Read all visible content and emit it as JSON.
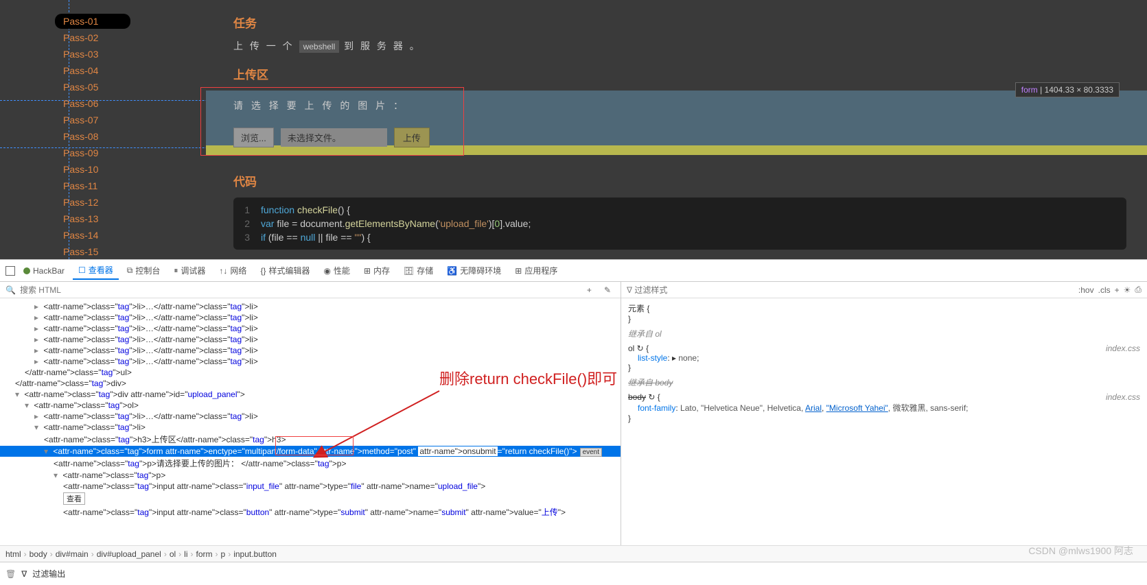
{
  "sidebar": {
    "items": [
      {
        "label": "Pass-01",
        "active": true
      },
      {
        "label": "Pass-02",
        "active": false
      },
      {
        "label": "Pass-03",
        "active": false
      },
      {
        "label": "Pass-04",
        "active": false
      },
      {
        "label": "Pass-05",
        "active": false
      },
      {
        "label": "Pass-06",
        "active": false
      },
      {
        "label": "Pass-07",
        "active": false
      },
      {
        "label": "Pass-08",
        "active": false
      },
      {
        "label": "Pass-09",
        "active": false
      },
      {
        "label": "Pass-10",
        "active": false
      },
      {
        "label": "Pass-11",
        "active": false
      },
      {
        "label": "Pass-12",
        "active": false
      },
      {
        "label": "Pass-13",
        "active": false
      },
      {
        "label": "Pass-14",
        "active": false
      },
      {
        "label": "Pass-15",
        "active": false
      }
    ]
  },
  "main": {
    "task_title": "任务",
    "task_prefix": "上 传 一 个 ",
    "task_code": "webshell",
    "task_suffix": " 到 服 务 器 。",
    "upload_title": "上传区",
    "upload_label": "请 选 择 要 上 传 的 图 片 ：",
    "browse_label": "浏览...",
    "file_status": "未选择文件。",
    "upload_button": "上传",
    "code_title": "代码",
    "dimensions_tooltip_tag": "form",
    "dimensions_tooltip_size": "1404.33 × 80.3333"
  },
  "code": {
    "lines": [
      {
        "n": "1",
        "html": "<span class='kw'>function</span> <span class='fn'>checkFile</span>() {"
      },
      {
        "n": "2",
        "html": "    <span class='kw'>var</span> file = document.<span class='fn'>getElementsByName</span>(<span class='str'>'upload_file'</span>)[<span class='num'>0</span>].value;"
      },
      {
        "n": "3",
        "html": "    <span class='kw'>if</span> (file == <span class='kw'>null</span> || file == <span class='str'>\"\"</span>) {"
      }
    ]
  },
  "devtools": {
    "tabs": {
      "hackbar": "HackBar",
      "inspector": "查看器",
      "console": "控制台",
      "debugger": "调试器",
      "network": "网络",
      "style_editor": "样式编辑器",
      "performance": "性能",
      "memory": "内存",
      "storage": "存储",
      "accessibility": "无障碍环境",
      "application": "应用程序"
    },
    "search_placeholder": "搜索 HTML",
    "add_button": "+",
    "styles_filter_placeholder": "过滤样式",
    "styles_toolbar": {
      "hov": ":hov",
      "cls": ".cls"
    },
    "styles": {
      "element_label": "元素",
      "inherit_ol": "继承自 ol",
      "ol_selector": "ol",
      "ol_src": "index.css",
      "list_style_prop": "list-style",
      "list_style_val": "none",
      "inherit_body_strike": "继承自 body",
      "body_selector": "body",
      "body_src": "index.css",
      "font_family_prop": "font-family",
      "font_family_val_plain": "Lato, \"Helvetica Neue\", Helvetica, ",
      "font_family_arial": "Arial",
      "font_family_ms": "\"Microsoft Yahei\"",
      "font_family_tail": ", 微软雅黑, sans-serif;"
    },
    "dom": {
      "li_generic": "<li>…</li>",
      "ul_close": "</ul>",
      "div_close": "</div>",
      "div_upload": "<div id=\"upload_panel\">",
      "ol_open": "<ol>",
      "li_open": "<li>",
      "h3_text": "上传区",
      "form_line_pre": "<form enctype=\"multipart/form-data\" method=\"post\" ",
      "form_attr": "onsubmit=\"return checkFile()\"",
      "form_line_post": ">",
      "event_badge": "event",
      "p_text": "请选择要上传的图片：",
      "p_open": "<p>",
      "p_close": "</p>",
      "input_file": "<input class=\"input_file\" type=\"file\" name=\"upload_file\">",
      "edit_label": "查看",
      "input_submit": "<input class=\"button\" type=\"submit\" name=\"submit\" value=\"上传\">"
    },
    "breadcrumb": [
      "html",
      "body",
      "div#main",
      "div#upload_panel",
      "ol",
      "li",
      "form",
      "p",
      "input.button"
    ],
    "filter_output": "过滤输出"
  },
  "annotation": "删除return checkFile()即可",
  "watermark": "CSDN @mlws1900 阿志"
}
